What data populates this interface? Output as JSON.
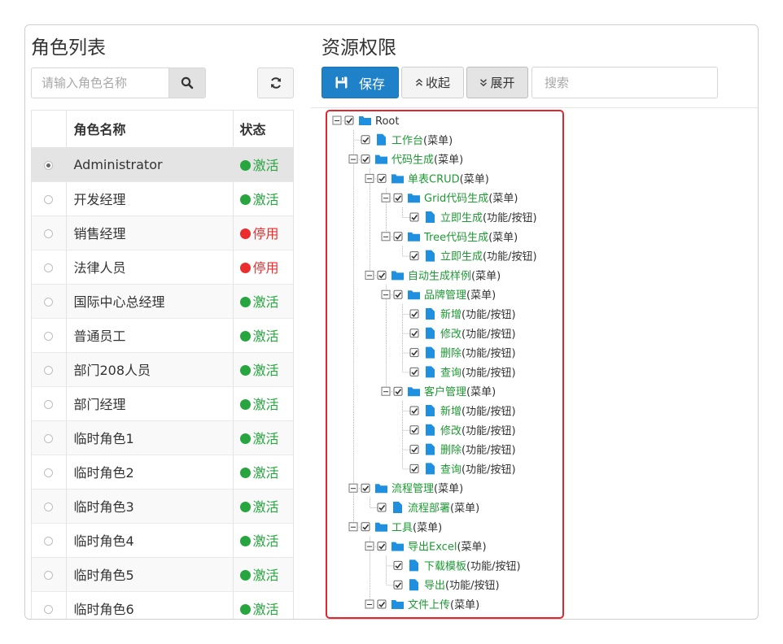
{
  "left": {
    "title": "角色列表",
    "search_placeholder": "请输入角色名称",
    "columns": {
      "name": "角色名称",
      "status": "状态"
    },
    "roles": [
      {
        "name": "Administrator",
        "status": "激活",
        "selected": true
      },
      {
        "name": "开发经理",
        "status": "激活"
      },
      {
        "name": "销售经理",
        "status": "停用"
      },
      {
        "name": "法律人员",
        "status": "停用"
      },
      {
        "name": "国际中心总经理",
        "status": "激活"
      },
      {
        "name": "普通员工",
        "status": "激活"
      },
      {
        "name": "部门208人员",
        "status": "激活"
      },
      {
        "name": "部门经理",
        "status": "激活"
      },
      {
        "name": "临时角色1",
        "status": "激活"
      },
      {
        "name": "临时角色2",
        "status": "激活"
      },
      {
        "name": "临时角色3",
        "status": "激活"
      },
      {
        "name": "临时角色4",
        "status": "激活"
      },
      {
        "name": "临时角色5",
        "status": "激活"
      },
      {
        "name": "临时角色6",
        "status": "激活"
      }
    ]
  },
  "right": {
    "title": "资源权限",
    "save_label": "保存",
    "collapse_label": "收起",
    "expand_label": "展开",
    "search_placeholder": "搜索"
  },
  "colors": {
    "active": "#27a640",
    "inactive": "#ec2d2d",
    "link_green": "#1d9a33",
    "primary": "#1f82c9",
    "folder_blue": "#1f8fe0",
    "highlight_border": "#e0262e"
  },
  "icons": {
    "search": "search-icon",
    "refresh": "refresh-icon",
    "save": "floppy-disk-icon",
    "collapse": "double-chevron-up-icon",
    "expand": "double-chevron-down-icon",
    "folder": "folder-icon",
    "file": "file-icon",
    "checkbox": "checkbox-checked-icon",
    "toggle": "tree-toggle-icon"
  },
  "tree": [
    {
      "label": "Root",
      "suffix": "",
      "children": [
        {
          "label": "工作台",
          "suffix": "(菜单)"
        },
        {
          "label": "代码生成",
          "suffix": "(菜单)",
          "children": [
            {
              "label": "单表CRUD",
              "suffix": "(菜单)",
              "children": [
                {
                  "label": "Grid代码生成",
                  "suffix": "(菜单)",
                  "children": [
                    {
                      "label": "立即生成",
                      "suffix": "(功能/按钮)"
                    }
                  ]
                },
                {
                  "label": "Tree代码生成",
                  "suffix": "(菜单)",
                  "children": [
                    {
                      "label": "立即生成",
                      "suffix": "(功能/按钮)"
                    }
                  ]
                }
              ]
            },
            {
              "label": "自动生成样例",
              "suffix": "(菜单)",
              "children": [
                {
                  "label": "品牌管理",
                  "suffix": "(菜单)",
                  "children": [
                    {
                      "label": "新增",
                      "suffix": "(功能/按钮)"
                    },
                    {
                      "label": "修改",
                      "suffix": "(功能/按钮)"
                    },
                    {
                      "label": "删除",
                      "suffix": "(功能/按钮)"
                    },
                    {
                      "label": "查询",
                      "suffix": "(功能/按钮)"
                    }
                  ]
                },
                {
                  "label": "客户管理",
                  "suffix": "(菜单)",
                  "children": [
                    {
                      "label": "新增",
                      "suffix": "(功能/按钮)"
                    },
                    {
                      "label": "修改",
                      "suffix": "(功能/按钮)"
                    },
                    {
                      "label": "删除",
                      "suffix": "(功能/按钮)"
                    },
                    {
                      "label": "查询",
                      "suffix": "(功能/按钮)"
                    }
                  ]
                }
              ]
            }
          ]
        },
        {
          "label": "流程管理",
          "suffix": "(菜单)",
          "children": [
            {
              "label": "流程部署",
              "suffix": "(菜单)"
            }
          ]
        },
        {
          "label": "工具",
          "suffix": "(菜单)",
          "children": [
            {
              "label": "导出Excel",
              "suffix": "(菜单)",
              "children": [
                {
                  "label": "下载模板",
                  "suffix": "(功能/按钮)"
                },
                {
                  "label": "导出",
                  "suffix": "(功能/按钮)"
                }
              ]
            },
            {
              "label": "文件上传",
              "suffix": "(菜单)",
              "children": []
            }
          ]
        }
      ]
    }
  ]
}
